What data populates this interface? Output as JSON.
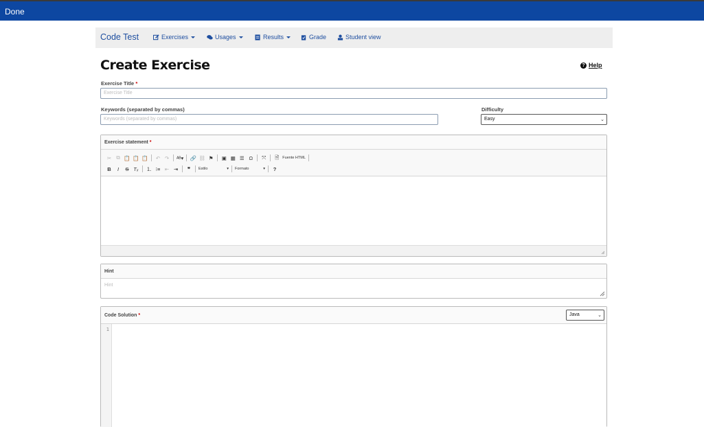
{
  "topbar": {
    "done_label": "Done"
  },
  "navbar": {
    "brand": "Code Test",
    "items": [
      {
        "label": "Exercises",
        "icon": "edit-icon",
        "dropdown": true
      },
      {
        "label": "Usages",
        "icon": "comments-icon",
        "dropdown": true
      },
      {
        "label": "Results",
        "icon": "results-icon",
        "dropdown": true
      },
      {
        "label": "Grade",
        "icon": "clipboard-icon",
        "dropdown": false
      },
      {
        "label": "Student view",
        "icon": "user-icon",
        "dropdown": false
      }
    ]
  },
  "page": {
    "title": "Create Exercise",
    "help_label": "Help"
  },
  "form": {
    "title_label": "Exercise Title",
    "title_placeholder": "Exercise Title",
    "keywords_label": "Keywords (separated by commas)",
    "keywords_placeholder": "Keywords (separated by commas)",
    "difficulty_label": "Difficulty",
    "difficulty_value": "Easy",
    "required_mark": "*",
    "statement_label": "Exercise statement",
    "hint_label": "Hint",
    "hint_placeholder": "Hint",
    "code_label": "Code Solution",
    "language_value": "Java",
    "line_number": "1"
  },
  "editor_toolbar": {
    "source_html": "Fuente HTML",
    "style_combo": "Estilo",
    "format_combo": "Formato",
    "help_button": "?"
  },
  "colors": {
    "header_blue": "#0d47a1",
    "link_blue": "#1f4fa0",
    "required_red": "#cc0000"
  }
}
